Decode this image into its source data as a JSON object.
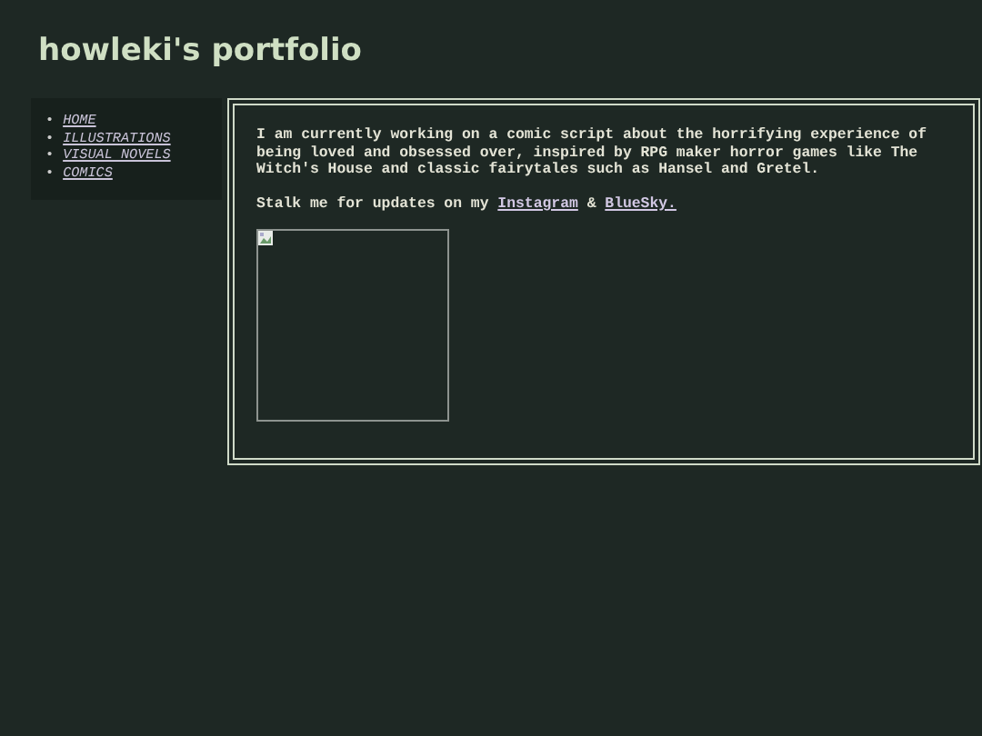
{
  "site_title": "howleki's portfolio",
  "nav": [
    {
      "marker": "•",
      "label": "HOME"
    },
    {
      "marker": "•",
      "label": "ILLUSTRATIONS"
    },
    {
      "marker": "•",
      "label": "VISUAL NOVELS"
    },
    {
      "marker": "•",
      "label": "COMICS"
    }
  ],
  "intro": "I am currently working on a comic script about the horrifying experience of being loved and obsessed over, inspired by RPG maker horror games like The Witch's House and classic fairytales such as Hansel and Gretel.",
  "updates": [
    {
      "kind": "text",
      "text": "Stalk me for updates on my "
    },
    {
      "kind": "link",
      "text": "Instagram"
    },
    {
      "kind": "text",
      "text": " & "
    },
    {
      "kind": "link",
      "text": "BlueSky."
    }
  ],
  "image": {
    "kind": "picture",
    "broken": true
  }
}
